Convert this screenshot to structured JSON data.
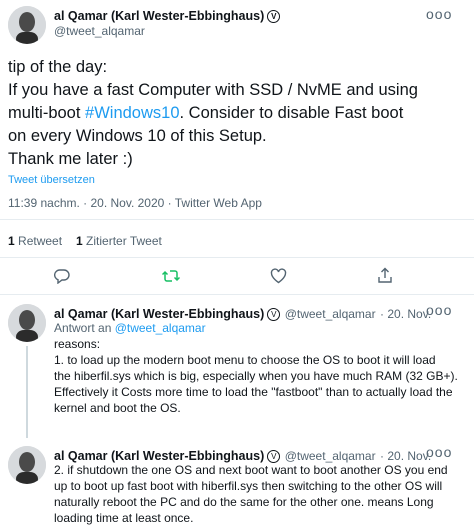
{
  "tweet": {
    "author_name": "al Qamar (Karl Wester-Ebbinghaus)",
    "verified_glyph": "V",
    "handle": "@tweet_alqamar",
    "more": "ooo",
    "text_lines": [
      "tip of the day:",
      "If you have a fast Computer with SSD / NvME and using",
      "multi-boot ",
      ". Consider to disable Fast boot",
      "on every Windows 10 of this Setup.",
      "Thank me later :)"
    ],
    "hashtag": "#Windows10",
    "translate_link": "Tweet übersetzen",
    "timestamp": "11:39 nachm. · 20. Nov. 2020 · Twitter Web App",
    "stats": {
      "retweet_count": "1",
      "retweet_label": "Retweet",
      "quote_count": "1",
      "quote_label": "Zitierter Tweet"
    }
  },
  "actions": {
    "reply_icon": "reply-icon",
    "retweet_icon": "retweet-icon",
    "like_icon": "heart-icon",
    "share_icon": "share-icon",
    "retweet_color": "#17bf63"
  },
  "replies": [
    {
      "author_name": "al Qamar (Karl Wester-Ebbinghaus)",
      "verified_glyph": "V",
      "handle": "@tweet_alqamar",
      "date": "· 20. Nov.",
      "reply_to_label": "Antwort an ",
      "reply_to_handle": "@tweet_alqamar",
      "lines": [
        "reasons:",
        "1. to load up the modern boot menu to choose the OS to boot it will load",
        "the hiberfil.sys which is big, especially when you have much RAM (32 GB+).",
        "Effectively it Costs more time to load the \"fastboot\" than to actually load the",
        "kernel and boot the OS."
      ],
      "more": "ooo"
    },
    {
      "author_name": "al Qamar (Karl Wester-Ebbinghaus)",
      "verified_glyph": "V",
      "handle": "@tweet_alqamar",
      "date": "· 20. Nov.",
      "lines": [
        "2. if shutdown the one OS and next boot want to boot another OS you end",
        "up to boot up fast boot with hiberfil.sys then switching to the other OS will",
        "naturally reboot the PC and do the same for the other one. means Long",
        "loading time at least once."
      ],
      "more": "ooo"
    }
  ],
  "colors": {
    "accent": "#1d9bf0",
    "muted": "#536471",
    "divider": "#e6ecf0"
  }
}
